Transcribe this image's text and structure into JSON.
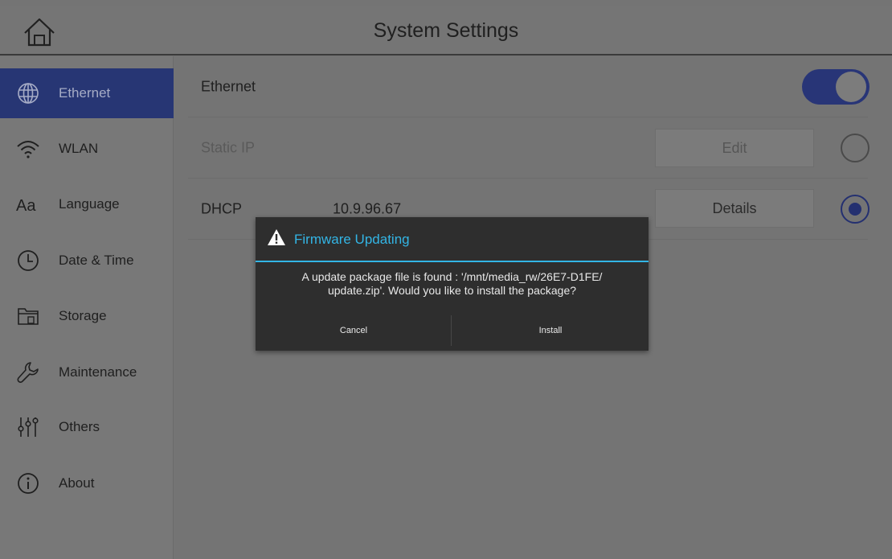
{
  "header": {
    "title": "System Settings",
    "home_icon": "home-icon"
  },
  "sidebar": {
    "items": [
      {
        "label": "Ethernet",
        "icon": "globe-icon",
        "active": true
      },
      {
        "label": "WLAN",
        "icon": "wifi-icon",
        "active": false
      },
      {
        "label": "Language",
        "icon": "font-icon",
        "active": false
      },
      {
        "label": "Date & Time",
        "icon": "clock-icon",
        "active": false
      },
      {
        "label": "Storage",
        "icon": "folder-icon",
        "active": false
      },
      {
        "label": "Maintenance",
        "icon": "wrench-icon",
        "active": false
      },
      {
        "label": "Others",
        "icon": "sliders-icon",
        "active": false
      },
      {
        "label": "About",
        "icon": "info-icon",
        "active": false
      }
    ]
  },
  "main": {
    "ethernet": {
      "label": "Ethernet",
      "enabled": true
    },
    "static_ip": {
      "label": "Static IP",
      "button": "Edit",
      "selected": false
    },
    "dhcp": {
      "label": "DHCP",
      "value": "10.9.96.67",
      "button": "Details",
      "selected": true
    }
  },
  "dialog": {
    "title": "Firmware Updating",
    "message_line1": "A update package file is found : '/mnt/media_rw/26E7-D1FE/",
    "message_line2": "update.zip'. Would you like to install the package?",
    "cancel_label": "Cancel",
    "install_label": "Install"
  },
  "colors": {
    "accent": "#283577",
    "dialog_title": "#33b5e5",
    "dialog_bg": "#2e2e2e"
  }
}
